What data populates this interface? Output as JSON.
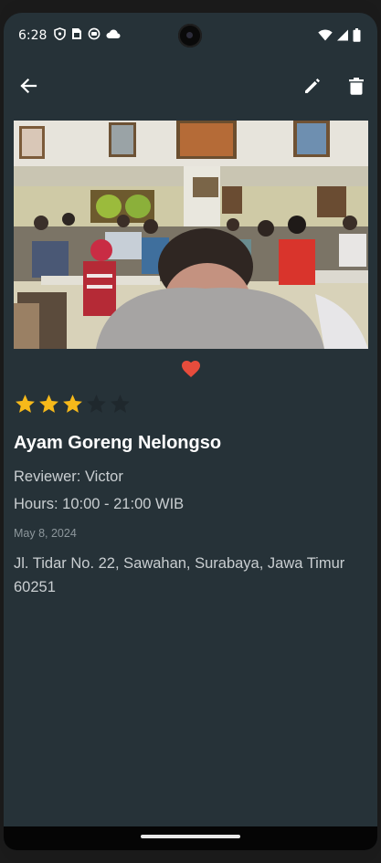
{
  "status_bar": {
    "time": "6:28",
    "left_icons": [
      "vpn-shield-icon",
      "sim-card-icon",
      "app-status-icon",
      "cloud-icon"
    ],
    "right_icons": [
      "wifi-icon",
      "cellular-signal-icon",
      "battery-icon"
    ]
  },
  "app_bar": {
    "back_icon": "arrow-back-icon",
    "edit_icon": "pencil-icon",
    "delete_icon": "trash-icon"
  },
  "review": {
    "favorite": true,
    "rating": 3,
    "max_rating": 5,
    "name": "Ayam Goreng Nelongso",
    "reviewer": "Reviewer: Victor",
    "hours": "Hours: 10:00 - 21:00 WIB",
    "date": "May 8, 2024",
    "address": "Jl. Tidar No. 22, Sawahan, Surabaya, Jawa Timur 60251"
  },
  "colors": {
    "background": "#263238",
    "star_filled": "#f6b91a",
    "star_empty": "#1f282d",
    "favorite": "#e74c3c"
  }
}
